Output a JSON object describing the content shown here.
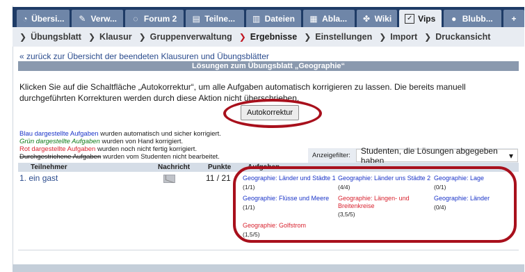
{
  "tabs": [
    {
      "icon": "compass-icon",
      "glyph": "◔",
      "label": "Übersi..."
    },
    {
      "icon": "wrench-icon",
      "glyph": "✎",
      "label": "Verw..."
    },
    {
      "icon": "speech-bubble-icon",
      "glyph": "◌",
      "label": "Forum 2"
    },
    {
      "icon": "participants-icon",
      "glyph": "▤",
      "label": "Teilne..."
    },
    {
      "icon": "files-icon",
      "glyph": "▥",
      "label": "Dateien"
    },
    {
      "icon": "schedule-icon",
      "glyph": "▦",
      "label": "Abla..."
    },
    {
      "icon": "wiki-icon",
      "glyph": "✤",
      "label": "Wiki"
    },
    {
      "icon": "checkbox-icon",
      "glyph": "✓",
      "label": "Vips",
      "active": true
    },
    {
      "icon": "blubber-icon",
      "glyph": "●",
      "label": "Blubb..."
    },
    {
      "icon": "plus-icon",
      "glyph": "+",
      "label": ""
    }
  ],
  "subnav": [
    {
      "label": "Übungsblatt"
    },
    {
      "label": "Klausur"
    },
    {
      "label": "Gruppenverwaltung"
    },
    {
      "label": "Ergebnisse",
      "active": true
    },
    {
      "label": "Einstellungen"
    },
    {
      "label": "Import"
    },
    {
      "label": "Druckansicht"
    }
  ],
  "back_link": "« zurück zur Übersicht der beendeten Klausuren und Übungsblätter",
  "section_title": "Lösungen zum Übungsblatt „Geographie“",
  "info_text": "Klicken Sie auf die Schaltfläche „Autokorrektur“, um alle Aufgaben automatisch korrigieren zu lassen. Die bereits manuell durchgeführten Korrekturen werden durch diese Aktion nicht überschrieben.",
  "autocorrect_label": "Autokorrektur",
  "legend": {
    "blue_term": "Blau dargestellte Aufgaben",
    "blue_rest": " wurden automatisch und sicher korrigiert.",
    "green_term": "Grün dargestellte Aufgaben",
    "green_rest": " wurden von Hand korrigiert.",
    "red_term": "Rot dargestellte Aufgaben",
    "red_rest": " wurden noch nicht fertig korrigiert.",
    "strike_term": "Durchgestrichene Aufgaben",
    "strike_rest": " wurden vom Studenten nicht bearbeitet."
  },
  "filter": {
    "label": "Anzeigefilter:",
    "value": "Studenten, die Lösungen abgegeben haben",
    "arrow": "▾"
  },
  "table": {
    "headers": [
      "Teilnehmer",
      "Nachricht",
      "Punkte",
      "Aufgaben"
    ],
    "row": {
      "participant": "1. ein gast",
      "points": "11 / 21",
      "answers": [
        {
          "title": "Geographie: Länder und Städte 1",
          "score": "(1/1)",
          "color": "blue"
        },
        {
          "title": "Geographie: Länder uns Städte 2",
          "score": "(4/4)",
          "color": "blue"
        },
        {
          "title": "Geographie: Lage",
          "score": "(0/1)",
          "color": "blue"
        },
        {
          "title": "Geographie: Flüsse und Meere",
          "score": "(1/1)",
          "color": "blue"
        },
        {
          "title": "Geographie: Längen- und Breitenkreise",
          "score": "(3,5/5)",
          "color": "red"
        },
        {
          "title": "Geographie: Länder",
          "score": "(0/4)",
          "color": "blue"
        },
        {
          "title": "Geographie: Golfstrom",
          "score": "(1,5/5)",
          "color": "red"
        }
      ]
    }
  }
}
